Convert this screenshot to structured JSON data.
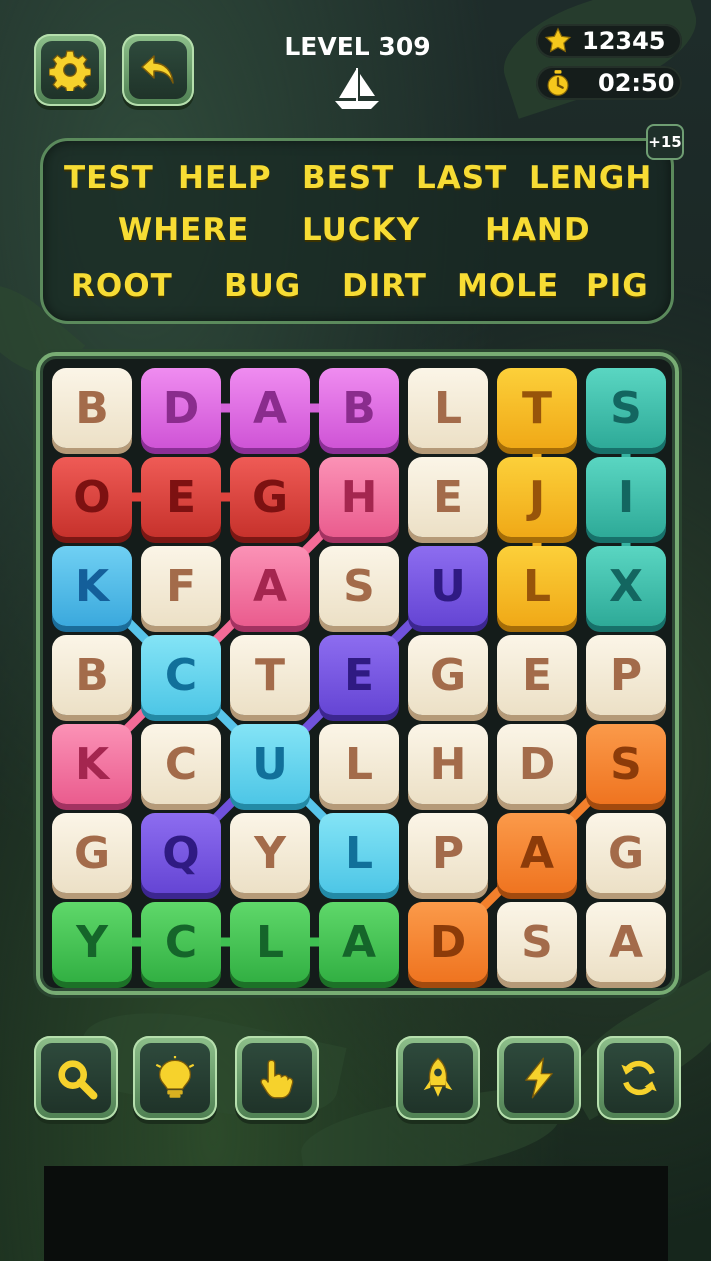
{
  "header": {
    "level_label": "LEVEL 309",
    "stars": "12345",
    "timer": "02:50"
  },
  "top_buttons": {
    "settings": "gear-icon",
    "back": "back-arrow-icon"
  },
  "words": {
    "bonus_badge": "+15",
    "list": [
      "TEST",
      "HELP",
      "BEST",
      "LAST",
      "LENGH",
      "WHERE",
      "LUCKY",
      "HAND",
      "ROOT",
      "BUG",
      "DIRT",
      "MOLE",
      "PIG"
    ]
  },
  "grid": {
    "rows": [
      [
        {
          "l": "B",
          "c": "cream"
        },
        {
          "l": "D",
          "c": "magenta"
        },
        {
          "l": "A",
          "c": "magenta"
        },
        {
          "l": "B",
          "c": "magenta"
        },
        {
          "l": "L",
          "c": "cream"
        },
        {
          "l": "T",
          "c": "yellow"
        },
        {
          "l": "S",
          "c": "teal"
        }
      ],
      [
        {
          "l": "O",
          "c": "red"
        },
        {
          "l": "E",
          "c": "red"
        },
        {
          "l": "G",
          "c": "red"
        },
        {
          "l": "H",
          "c": "pink"
        },
        {
          "l": "E",
          "c": "cream"
        },
        {
          "l": "J",
          "c": "yellow"
        },
        {
          "l": "I",
          "c": "teal"
        }
      ],
      [
        {
          "l": "K",
          "c": "blue"
        },
        {
          "l": "F",
          "c": "cream"
        },
        {
          "l": "A",
          "c": "pink"
        },
        {
          "l": "S",
          "c": "cream"
        },
        {
          "l": "U",
          "c": "purple"
        },
        {
          "l": "L",
          "c": "yellow"
        },
        {
          "l": "X",
          "c": "teal"
        }
      ],
      [
        {
          "l": "B",
          "c": "cream"
        },
        {
          "l": "C",
          "c": "cyan"
        },
        {
          "l": "T",
          "c": "cream"
        },
        {
          "l": "E",
          "c": "purple"
        },
        {
          "l": "G",
          "c": "cream"
        },
        {
          "l": "E",
          "c": "cream"
        },
        {
          "l": "P",
          "c": "cream"
        }
      ],
      [
        {
          "l": "K",
          "c": "pink"
        },
        {
          "l": "C",
          "c": "cream"
        },
        {
          "l": "U",
          "c": "cyan"
        },
        {
          "l": "L",
          "c": "cream"
        },
        {
          "l": "H",
          "c": "cream"
        },
        {
          "l": "D",
          "c": "cream"
        },
        {
          "l": "S",
          "c": "orange"
        }
      ],
      [
        {
          "l": "G",
          "c": "cream"
        },
        {
          "l": "Q",
          "c": "purple"
        },
        {
          "l": "Y",
          "c": "cream"
        },
        {
          "l": "L",
          "c": "cyan"
        },
        {
          "l": "P",
          "c": "cream"
        },
        {
          "l": "A",
          "c": "orange"
        },
        {
          "l": "G",
          "c": "cream"
        }
      ],
      [
        {
          "l": "Y",
          "c": "green"
        },
        {
          "l": "C",
          "c": "green"
        },
        {
          "l": "L",
          "c": "green"
        },
        {
          "l": "A",
          "c": "green"
        },
        {
          "l": "D",
          "c": "orange"
        },
        {
          "l": "S",
          "c": "cream"
        },
        {
          "l": "A",
          "c": "cream"
        }
      ]
    ],
    "found_paths": [
      {
        "color": "#d563d9",
        "cells": [
          [
            0,
            1
          ],
          [
            0,
            2
          ],
          [
            0,
            3
          ]
        ]
      },
      {
        "color": "#e0433d",
        "cells": [
          [
            1,
            0
          ],
          [
            1,
            1
          ],
          [
            1,
            2
          ]
        ]
      },
      {
        "color": "#f2b21f",
        "cells": [
          [
            0,
            5
          ],
          [
            1,
            5
          ],
          [
            2,
            5
          ]
        ]
      },
      {
        "color": "#36b3a1",
        "cells": [
          [
            0,
            6
          ],
          [
            1,
            6
          ],
          [
            2,
            6
          ]
        ]
      },
      {
        "color": "#f36b97",
        "cells": [
          [
            1,
            3
          ],
          [
            2,
            2
          ],
          [
            3,
            1
          ],
          [
            4,
            0
          ]
        ]
      },
      {
        "color": "#58c5ea",
        "cells": [
          [
            2,
            0
          ],
          [
            3,
            1
          ],
          [
            4,
            2
          ],
          [
            5,
            3
          ]
        ]
      },
      {
        "color": "#7052dc",
        "cells": [
          [
            2,
            4
          ],
          [
            3,
            3
          ],
          [
            4,
            2
          ],
          [
            5,
            1
          ]
        ]
      },
      {
        "color": "#3fc152",
        "cells": [
          [
            6,
            0
          ],
          [
            6,
            1
          ],
          [
            6,
            2
          ],
          [
            6,
            3
          ]
        ]
      },
      {
        "color": "#f3802c",
        "cells": [
          [
            4,
            6
          ],
          [
            5,
            5
          ],
          [
            6,
            4
          ]
        ]
      }
    ]
  },
  "tools": [
    {
      "icon": "magnifier-icon"
    },
    {
      "icon": "lightbulb-icon"
    },
    {
      "icon": "pointing-hand-icon"
    },
    {
      "icon": "rocket-icon"
    },
    {
      "icon": "lightning-icon"
    },
    {
      "icon": "refresh-icon"
    }
  ]
}
